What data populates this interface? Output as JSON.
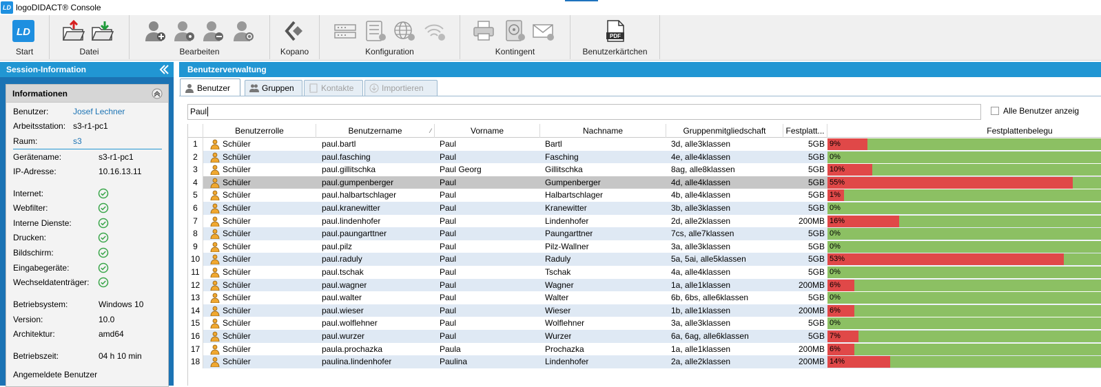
{
  "window": {
    "logo": "LD",
    "title": "logoDIDACT® Console"
  },
  "ribbon": {
    "groups": [
      {
        "label": "Start"
      },
      {
        "label": "Datei"
      },
      {
        "label": "Bearbeiten"
      },
      {
        "label": "Kopano"
      },
      {
        "label": "Konfiguration"
      },
      {
        "label": "Kontingent"
      },
      {
        "label": "Benutzerkärtchen"
      }
    ],
    "pdf_icon_text": "PDF",
    "ld_icon_text": "LD"
  },
  "session": {
    "header": "Session-Information",
    "info_title": "Informationen",
    "rows": [
      {
        "label": "Benutzer:",
        "value": "Josef Lechner"
      },
      {
        "label": "Arbeitsstation:",
        "value": "s3-r1-pc1"
      },
      {
        "label": "Raum:",
        "value": "s3"
      },
      {
        "label": "Gerätename:",
        "value": "s3-r1-pc1"
      },
      {
        "label": "IP-Adresse:",
        "value": "10.16.13.11"
      },
      {
        "label": "Internet:"
      },
      {
        "label": "Webfilter:"
      },
      {
        "label": "Interne Dienste:"
      },
      {
        "label": "Drucken:"
      },
      {
        "label": "Bildschirm:"
      },
      {
        "label": "Eingabegeräte:"
      },
      {
        "label": "Wechseldatenträger:"
      },
      {
        "label": "Betriebsystem:",
        "value": "Windows 10"
      },
      {
        "label": "Version:",
        "value": "10.0"
      },
      {
        "label": "Architektur:",
        "value": "amd64"
      },
      {
        "label": "Betriebszeit:",
        "value": "04 h 10 min"
      },
      {
        "label": "Angemeldete Benutzer"
      }
    ]
  },
  "main": {
    "header": "Benutzerverwaltung",
    "tabs": [
      {
        "label": "Benutzer"
      },
      {
        "label": "Gruppen"
      },
      {
        "label": "Kontakte"
      },
      {
        "label": "Importieren"
      }
    ],
    "search_value": "Paul",
    "show_all_label": "Alle Benutzer anzeig",
    "columns": [
      "Benutzerrolle",
      "Benutzername",
      "Vorname",
      "Nachname",
      "Gruppenmitgliedschaft",
      "Festplatt...",
      "Festplattenbelegu"
    ],
    "rows": [
      {
        "n": "1",
        "role": "Schüler",
        "user": "paul.bartl",
        "first": "Paul",
        "last": "Bartl",
        "groups": "3d, alle3klassen",
        "quota": "5GB",
        "usage": 9,
        "usage_label": "9%"
      },
      {
        "n": "2",
        "role": "Schüler",
        "user": "paul.fasching",
        "first": "Paul",
        "last": "Fasching",
        "groups": "4e, alle4klassen",
        "quota": "5GB",
        "usage": 0,
        "usage_label": "0%"
      },
      {
        "n": "3",
        "role": "Schüler",
        "user": "paul.gillitschka",
        "first": "Paul Georg",
        "last": "Gillitschka",
        "groups": "8ag, alle8klassen",
        "quota": "5GB",
        "usage": 10,
        "usage_label": "10%"
      },
      {
        "n": "4",
        "role": "Schüler",
        "user": "paul.gumpenberger",
        "first": "Paul",
        "last": "Gumpenberger",
        "groups": "4d, alle4klassen",
        "quota": "5GB",
        "usage": 55,
        "usage_label": "55%"
      },
      {
        "n": "5",
        "role": "Schüler",
        "user": "paul.halbartschlager",
        "first": "Paul",
        "last": "Halbartschlager",
        "groups": "4b, alle4klassen",
        "quota": "5GB",
        "usage": 1,
        "usage_label": "1%"
      },
      {
        "n": "6",
        "role": "Schüler",
        "user": "paul.kranewitter",
        "first": "Paul",
        "last": "Kranewitter",
        "groups": "3b, alle3klassen",
        "quota": "5GB",
        "usage": 0,
        "usage_label": "0%"
      },
      {
        "n": "7",
        "role": "Schüler",
        "user": "paul.lindenhofer",
        "first": "Paul",
        "last": "Lindenhofer",
        "groups": "2d, alle2klassen",
        "quota": "200MB",
        "usage": 16,
        "usage_label": "16%"
      },
      {
        "n": "8",
        "role": "Schüler",
        "user": "paul.paungarttner",
        "first": "Paul",
        "last": "Paungarttner",
        "groups": "7cs, alle7klassen",
        "quota": "5GB",
        "usage": 0,
        "usage_label": "0%"
      },
      {
        "n": "9",
        "role": "Schüler",
        "user": "paul.pilz",
        "first": "Paul",
        "last": "Pilz-Wallner",
        "groups": "3a, alle3klassen",
        "quota": "5GB",
        "usage": 0,
        "usage_label": "0%"
      },
      {
        "n": "10",
        "role": "Schüler",
        "user": "paul.raduly",
        "first": "Paul",
        "last": "Raduly",
        "groups": "5a, 5ai, alle5klassen",
        "quota": "5GB",
        "usage": 53,
        "usage_label": "53%"
      },
      {
        "n": "11",
        "role": "Schüler",
        "user": "paul.tschak",
        "first": "Paul",
        "last": "Tschak",
        "groups": "4a, alle4klassen",
        "quota": "5GB",
        "usage": 0,
        "usage_label": "0%"
      },
      {
        "n": "12",
        "role": "Schüler",
        "user": "paul.wagner",
        "first": "Paul",
        "last": "Wagner",
        "groups": "1a, alle1klassen",
        "quota": "200MB",
        "usage": 6,
        "usage_label": "6%"
      },
      {
        "n": "13",
        "role": "Schüler",
        "user": "paul.walter",
        "first": "Paul",
        "last": "Walter",
        "groups": "6b, 6bs, alle6klassen",
        "quota": "5GB",
        "usage": 0,
        "usage_label": "0%"
      },
      {
        "n": "14",
        "role": "Schüler",
        "user": "paul.wieser",
        "first": "Paul",
        "last": "Wieser",
        "groups": "1b, alle1klassen",
        "quota": "200MB",
        "usage": 6,
        "usage_label": "6%"
      },
      {
        "n": "15",
        "role": "Schüler",
        "user": "paul.wolflehner",
        "first": "Paul",
        "last": "Wolflehner",
        "groups": "3a, alle3klassen",
        "quota": "5GB",
        "usage": 0,
        "usage_label": "0%"
      },
      {
        "n": "16",
        "role": "Schüler",
        "user": "paul.wurzer",
        "first": "Paul",
        "last": "Wurzer",
        "groups": "6a, 6ag, alle6klassen",
        "quota": "5GB",
        "usage": 7,
        "usage_label": "7%"
      },
      {
        "n": "17",
        "role": "Schüler",
        "user": "paula.prochazka",
        "first": "Paula",
        "last": "Prochazka",
        "groups": "1a, alle1klassen",
        "quota": "200MB",
        "usage": 6,
        "usage_label": "6%"
      },
      {
        "n": "18",
        "role": "Schüler",
        "user": "paulina.lindenhofer",
        "first": "Paulina",
        "last": "Lindenhofer",
        "groups": "2a, alle2klassen",
        "quota": "200MB",
        "usage": 14,
        "usage_label": "14%"
      }
    ],
    "selected_row": 4
  },
  "colors": {
    "accent": "#2196d3",
    "usage_used": "#e04848",
    "usage_free": "#8cc063",
    "alt_row": "#dfe9f4",
    "selected_row": "#c6c6c6"
  }
}
